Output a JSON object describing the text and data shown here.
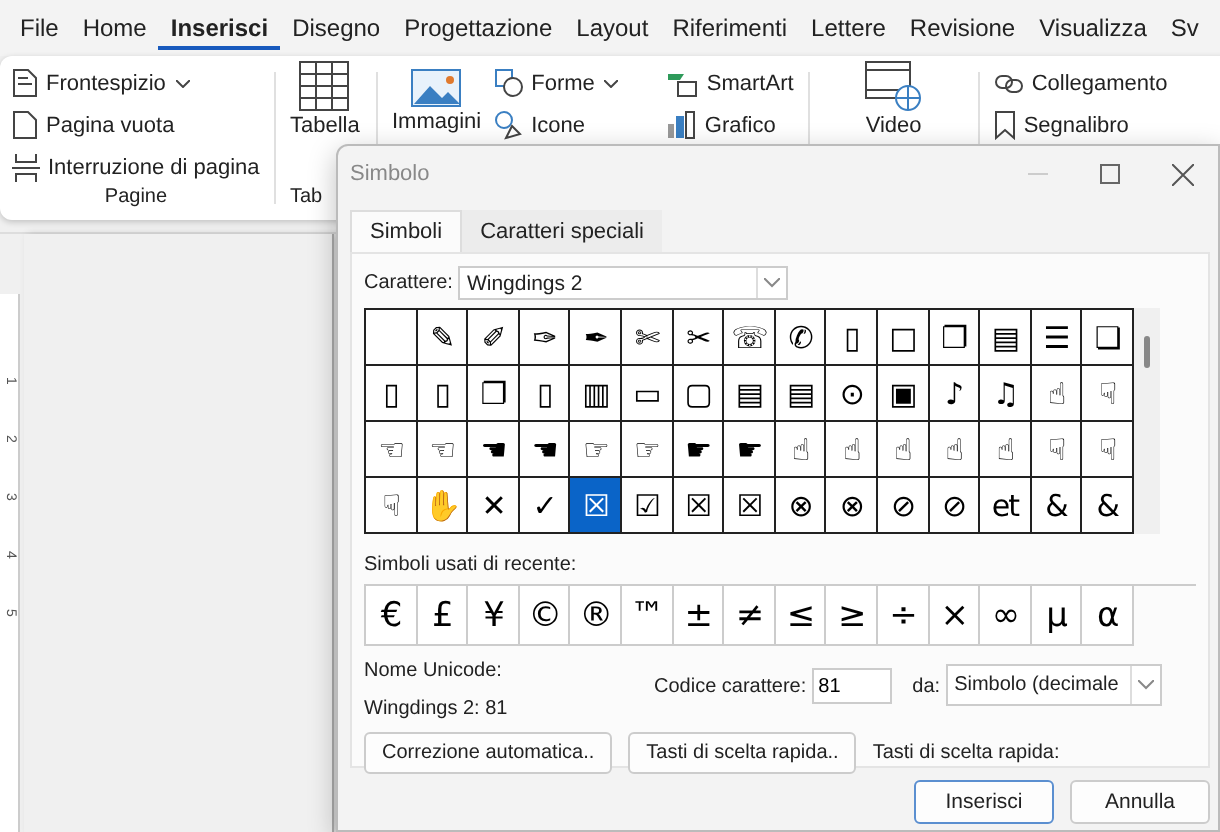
{
  "menu_tabs": [
    {
      "label": "File",
      "selected": false
    },
    {
      "label": "Home",
      "selected": false
    },
    {
      "label": "Inserisci",
      "selected": true
    },
    {
      "label": "Disegno",
      "selected": false
    },
    {
      "label": "Progettazione",
      "selected": false
    },
    {
      "label": "Layout",
      "selected": false
    },
    {
      "label": "Riferimenti",
      "selected": false
    },
    {
      "label": "Lettere",
      "selected": false
    },
    {
      "label": "Revisione",
      "selected": false
    },
    {
      "label": "Visualizza",
      "selected": false
    },
    {
      "label": "Sv",
      "selected": false
    }
  ],
  "ribbon": {
    "pagine": {
      "items": [
        {
          "kind": "cover",
          "label": "Frontespizio",
          "dropdown": true
        },
        {
          "kind": "page",
          "label": "Pagina vuota",
          "dropdown": false
        },
        {
          "kind": "break",
          "label": "Interruzione di pagina",
          "dropdown": false
        }
      ],
      "caption": "Pagine"
    },
    "tabelle": {
      "label": "Tabella",
      "caption": "Tab"
    },
    "immagini": {
      "label": "Immagini"
    },
    "illustrazioni": [
      {
        "kind": "shapes",
        "label": "Forme",
        "dropdown": true
      },
      {
        "kind": "icons",
        "label": "Icone",
        "dropdown": false
      }
    ],
    "grafici": [
      {
        "kind": "smartart",
        "label": "SmartArt"
      },
      {
        "kind": "chart",
        "label": "Grafico"
      }
    ],
    "video": {
      "label": "Video"
    },
    "collegamenti": [
      {
        "kind": "link",
        "label": "Collegamento"
      },
      {
        "kind": "bookmark",
        "label": "Segnalibro"
      }
    ]
  },
  "ruler_numbers": [
    "1",
    "2",
    "3",
    "4",
    "5"
  ],
  "dialog": {
    "title": "Simbolo",
    "tabs": [
      {
        "label": "Simboli",
        "selected": true
      },
      {
        "label": "Caratteri speciali",
        "selected": false
      }
    ],
    "font_label": "Carattere:",
    "font_value": "Wingdings 2",
    "symbols": [
      {
        "selected": false
      },
      {
        "char": "✎",
        "selected": false
      },
      {
        "char": "✐",
        "selected": false
      },
      {
        "char": "✑",
        "selected": false
      },
      {
        "char": "✒",
        "selected": false
      },
      {
        "char": "✄",
        "selected": false
      },
      {
        "char": "✂",
        "selected": false
      },
      {
        "char": "☏",
        "selected": false
      },
      {
        "char": "✆",
        "selected": false
      },
      {
        "char": "▯",
        "selected": false
      },
      {
        "char": "□",
        "selected": false
      },
      {
        "char": "❐",
        "selected": false
      },
      {
        "char": "▤",
        "selected": false
      },
      {
        "char": "☰",
        "selected": false
      },
      {
        "char": "❏",
        "selected": false
      },
      {
        "char": "▯",
        "selected": false
      },
      {
        "char": "▯",
        "selected": false
      },
      {
        "char": "❐",
        "selected": false
      },
      {
        "char": "▯",
        "selected": false
      },
      {
        "char": "▥",
        "selected": false
      },
      {
        "char": "▭",
        "selected": false
      },
      {
        "char": "▢",
        "selected": false
      },
      {
        "char": "▤",
        "selected": false
      },
      {
        "char": "▤",
        "selected": false
      },
      {
        "char": "⊙",
        "selected": false
      },
      {
        "char": "▣",
        "selected": false
      },
      {
        "char": "♪",
        "selected": false
      },
      {
        "char": "♫",
        "selected": false
      },
      {
        "char": "☝",
        "selected": false
      },
      {
        "char": "☟",
        "selected": false
      },
      {
        "char": "☜",
        "selected": false
      },
      {
        "char": "☜",
        "selected": false
      },
      {
        "char": "☚",
        "selected": false
      },
      {
        "char": "☚",
        "selected": false
      },
      {
        "char": "☞",
        "selected": false
      },
      {
        "char": "☞",
        "selected": false
      },
      {
        "char": "☛",
        "selected": false
      },
      {
        "char": "☛",
        "selected": false
      },
      {
        "char": "☝",
        "selected": false
      },
      {
        "char": "☝",
        "selected": false
      },
      {
        "char": "☝",
        "selected": false
      },
      {
        "char": "☝",
        "selected": false
      },
      {
        "char": "☝",
        "selected": false
      },
      {
        "char": "☟",
        "selected": false
      },
      {
        "char": "☟",
        "selected": false
      },
      {
        "char": "☟",
        "selected": false
      },
      {
        "char": "✋",
        "selected": false
      },
      {
        "char": "✕",
        "selected": false
      },
      {
        "char": "✓",
        "selected": false
      },
      {
        "char": "☒",
        "selected": true
      },
      {
        "char": "☑",
        "selected": false
      },
      {
        "char": "☒",
        "selected": false
      },
      {
        "char": "☒",
        "selected": false
      },
      {
        "char": "⊗",
        "selected": false
      },
      {
        "char": "⊗",
        "selected": false
      },
      {
        "char": "⊘",
        "selected": false
      },
      {
        "char": "⊘",
        "selected": false
      },
      {
        "char": "et",
        "selected": false
      },
      {
        "char": "&",
        "selected": false
      },
      {
        "char": "&",
        "selected": false
      }
    ],
    "recent_label": "Simboli usati di recente:",
    "recent": [
      "€",
      "£",
      "¥",
      "©",
      "®",
      "™",
      "±",
      "≠",
      "≤",
      "≥",
      "÷",
      "×",
      "∞",
      "µ",
      "α"
    ],
    "unicode_name_label": "Nome Unicode:",
    "unicode_name": "Wingdings 2: 81",
    "code_label": "Codice carattere:",
    "code_value": "81",
    "from_label": "da:",
    "from_value": "Simbolo (decimale",
    "buttons": [
      "Correzione automatica..",
      "Tasti di scelta rapida.."
    ],
    "shortcut_label": "Tasti di scelta rapida:",
    "footer_buttons": [
      {
        "kind": "primary",
        "label": "Inserisci"
      },
      {
        "kind": "cancel",
        "label": "Annulla"
      }
    ]
  }
}
